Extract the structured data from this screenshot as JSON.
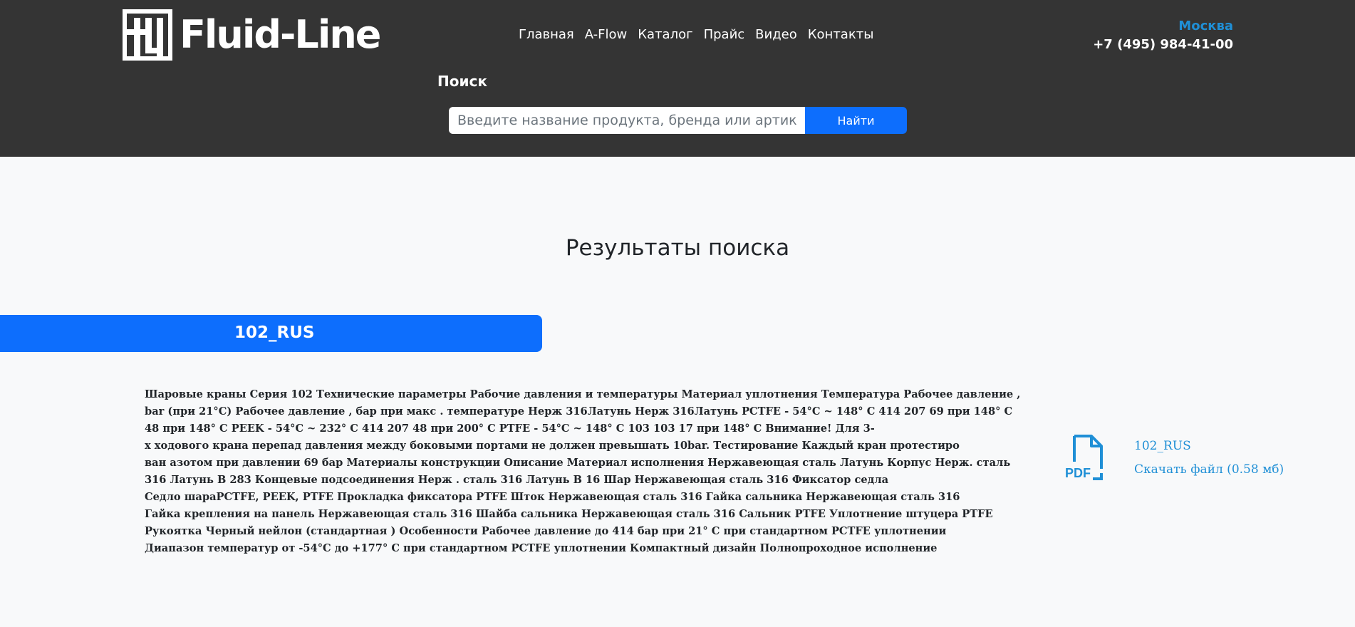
{
  "header": {
    "logo_text": "Fluid-Line",
    "nav": [
      {
        "label": "Главная"
      },
      {
        "label": "A-Flow"
      },
      {
        "label": "Каталог"
      },
      {
        "label": "Прайс"
      },
      {
        "label": "Видео"
      },
      {
        "label": "Контакты"
      }
    ],
    "city": "Москва",
    "phone": "+7 (495) 984-41-00",
    "search": {
      "label": "Поиск",
      "placeholder": "Введите название продукта, бренда или артикул",
      "value": "",
      "button_label": "Найти"
    }
  },
  "main": {
    "title": "Результаты поиска",
    "result": {
      "tab_title": "102_RUS",
      "text_lines": [
        "Шаровые краны Серия 102   Технические параметры   Рабочие давления и температуры  Материал  уплотнения  Температура  Рабочее давление ,",
        "bar  (при  21°C)  Рабочее давление , бар при макс . температуре  Нерж  316Латунь  Нерж  316Латунь PCTFE  - 54°C ~ 148° C  414  207  69 при  148° C",
        "48 при  148° C  PEEK  - 54°C ~ 232° C  414  207  48 при  200° C  PTFE  - 54°C ~ 148° C  103  103  17 при 148° C Внимание! Для  3-",
        "х ходового крана перепад давления между боковыми  портами не должен превышать  10bar.    Тестирование  Каждый кран протестиро",
        "ван азотом при давлении  69 бар  Материалы конструкции  Описание  Материал исполнения Нержавеющая сталь  Латунь Корпус Нерж. сталь",
        "316 Латунь В 283 Концевые подсоединения  Нерж . сталь  316 Латунь В 16  Шар Нержавеющая сталь 316 Фиксатор седла",
        "Седло шараPCTFE, PEEK, PTFE Прокладка фиксатора PTFE  Шток Нержавеющая сталь 316 Гайка сальника Нержавеющая сталь 316",
        "Гайка крепления на  панель  Нержавеющая сталь  316  Шайба сальника Нержавеющая сталь 316 Сальник PTFE  Уплотнение штуцера PTFE",
        "Рукоятка Черный нейлон (стандартная )     Особенности  Рабочее давление  до 414 бар при 21° C при стандартном  PCTFE уплотнении",
        "Диапазон температур  от -54°C до  +177° C при стандартном  PCTFE уплотнении   Компактный дизайн  Полнопроходное исполнение"
      ],
      "file": {
        "icon": "pdf-file-icon",
        "icon_label": "PDF",
        "name": "102_RUS",
        "download_label": "Скачать файл (0.58 мб)"
      }
    }
  },
  "colors": {
    "header_bg": "#343434",
    "accent": "#0d6efd",
    "link": "#1f8fd6",
    "page_bg": "#f8f9fa"
  }
}
